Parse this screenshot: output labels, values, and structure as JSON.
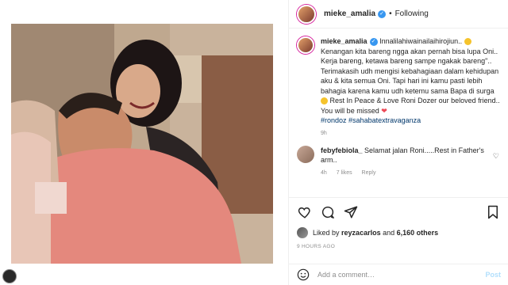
{
  "post": {
    "username": "mieke_amalia",
    "follow_status": "Following",
    "separator": "•"
  },
  "caption": {
    "username": "mieke_amalia",
    "text_1": "Innalilahiwainailaihirojiun..",
    "text_2": "Kenangan kita bareng ngga akan pernah bisa lupa Oni.. Kerja bareng, ketawa bareng sampe ngakak bareng\".. Terimakasih udh mengisi kebahagiaan dalam kehidupan aku & kita semua Oni. Tapi hari ini kamu pasti lebih bahagia karena kamu udh ketemu sama Bapa di surga",
    "text_3": "Rest In Peace & Love Roni Dozer our beloved friend.. You will be missed",
    "heart": "❤",
    "hashtag_1": "#rondoz",
    "hashtag_2": "#sahabatextravaganza",
    "time": "9h"
  },
  "comment": {
    "username": "febyfebiola_",
    "text": "Selamat jalan Roni.....Rest in Father's arm..",
    "time": "4h",
    "likes": "7 likes",
    "reply": "Reply"
  },
  "likes": {
    "prefix": "Liked by",
    "user": "reyzacarlos",
    "joiner": "and",
    "others": "6,160 others"
  },
  "date": "9 HOURS AGO",
  "comment_input": {
    "placeholder": "Add a comment…",
    "post_label": "Post"
  },
  "icons": {
    "header_verified": "verified-icon",
    "like": "heart-icon",
    "comment": "comment-icon",
    "share": "share-icon",
    "save": "bookmark-icon",
    "emoji": "smile-icon"
  },
  "colors": {
    "link": "#00376b",
    "verified": "#3897f0",
    "heart": "#ed4956",
    "post_button": "#b2dffc"
  }
}
